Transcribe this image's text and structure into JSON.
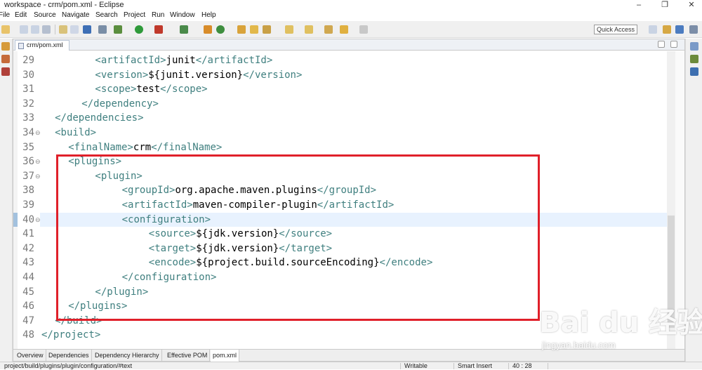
{
  "window": {
    "title": "workspace - crm/pom.xml - Eclipse",
    "minimize": "–",
    "restore": "❐",
    "close": "✕"
  },
  "menu": [
    "File",
    "Edit",
    "Source",
    "Navigate",
    "Search",
    "Project",
    "Run",
    "Window",
    "Help"
  ],
  "quick_access": "Quick Access",
  "editor_tab": "crm/pom.xml",
  "lines": [
    {
      "num": "29",
      "fold": "",
      "indent": 4,
      "parts": [
        [
          "t",
          "<artifactId>"
        ],
        [
          "x",
          "junit"
        ],
        [
          "t",
          "</artifactId>"
        ]
      ]
    },
    {
      "num": "30",
      "fold": "",
      "indent": 4,
      "parts": [
        [
          "t",
          "<version>"
        ],
        [
          "x",
          "${junit.version}"
        ],
        [
          "t",
          "</version>"
        ]
      ]
    },
    {
      "num": "31",
      "fold": "",
      "indent": 4,
      "parts": [
        [
          "t",
          "<scope>"
        ],
        [
          "x",
          "test"
        ],
        [
          "t",
          "</scope>"
        ]
      ]
    },
    {
      "num": "32",
      "fold": "",
      "indent": 3,
      "parts": [
        [
          "t",
          "</dependency>"
        ]
      ]
    },
    {
      "num": "33",
      "fold": "",
      "indent": 1,
      "parts": [
        [
          "t",
          "</dependencies>"
        ]
      ]
    },
    {
      "num": "34",
      "fold": "⊖",
      "indent": 1,
      "parts": [
        [
          "t",
          "<build>"
        ]
      ]
    },
    {
      "num": "35",
      "fold": "",
      "indent": 2,
      "parts": [
        [
          "t",
          "<finalName>"
        ],
        [
          "x",
          "crm"
        ],
        [
          "t",
          "</finalName>"
        ]
      ]
    },
    {
      "num": "36",
      "fold": "⊖",
      "indent": 2,
      "parts": [
        [
          "t",
          "<plugins>"
        ]
      ]
    },
    {
      "num": "37",
      "fold": "⊖",
      "indent": 4,
      "parts": [
        [
          "t",
          "<plugin>"
        ]
      ]
    },
    {
      "num": "38",
      "fold": "",
      "indent": 6,
      "parts": [
        [
          "t",
          "<groupId>"
        ],
        [
          "x",
          "org.apache.maven.plugins"
        ],
        [
          "t",
          "</groupId>"
        ]
      ]
    },
    {
      "num": "39",
      "fold": "",
      "indent": 6,
      "parts": [
        [
          "t",
          "<artifactId>"
        ],
        [
          "x",
          "maven-compiler-plugin"
        ],
        [
          "t",
          "</artifactId>"
        ]
      ]
    },
    {
      "num": "40",
      "fold": "⊖",
      "indent": 6,
      "parts": [
        [
          "t",
          "<configuration>"
        ]
      ]
    },
    {
      "num": "41",
      "fold": "",
      "indent": 8,
      "parts": [
        [
          "t",
          "<source>"
        ],
        [
          "x",
          "${jdk.version}"
        ],
        [
          "t",
          "</source>"
        ]
      ]
    },
    {
      "num": "42",
      "fold": "",
      "indent": 8,
      "parts": [
        [
          "t",
          "<target>"
        ],
        [
          "x",
          "${jdk.version}"
        ],
        [
          "t",
          "</target>"
        ]
      ]
    },
    {
      "num": "43",
      "fold": "",
      "indent": 8,
      "parts": [
        [
          "t",
          "<encode>"
        ],
        [
          "x",
          "${project.build.sourceEncoding}"
        ],
        [
          "t",
          "</encode>"
        ]
      ]
    },
    {
      "num": "44",
      "fold": "",
      "indent": 6,
      "parts": [
        [
          "t",
          "</configuration>"
        ]
      ]
    },
    {
      "num": "45",
      "fold": "",
      "indent": 4,
      "parts": [
        [
          "t",
          "</plugin>"
        ]
      ]
    },
    {
      "num": "46",
      "fold": "",
      "indent": 2,
      "parts": [
        [
          "t",
          "</plugins>"
        ]
      ]
    },
    {
      "num": "47",
      "fold": "",
      "indent": 1,
      "parts": [
        [
          "t",
          "</build>"
        ]
      ]
    },
    {
      "num": "48",
      "fold": "",
      "indent": 0,
      "parts": [
        [
          "t",
          "</project>"
        ]
      ]
    }
  ],
  "current_line": "40",
  "bottom_tabs": [
    "Overview",
    "Dependencies",
    "Dependency Hierarchy",
    "Effective POM",
    "pom.xml"
  ],
  "active_bottom_tab": "pom.xml",
  "status": {
    "path": "project/build/plugins/plugin/configuration/#text",
    "mode": "Writable",
    "insert": "Smart Insert",
    "position": "40 : 28"
  },
  "watermark": {
    "logo": "Bai du 经验",
    "url": "jingyan.baidu.com"
  },
  "colors": {
    "tag": "#3f7f7f",
    "text": "#000000",
    "highlight": "#e8f2fe",
    "annotation_box": "#e0202a"
  }
}
